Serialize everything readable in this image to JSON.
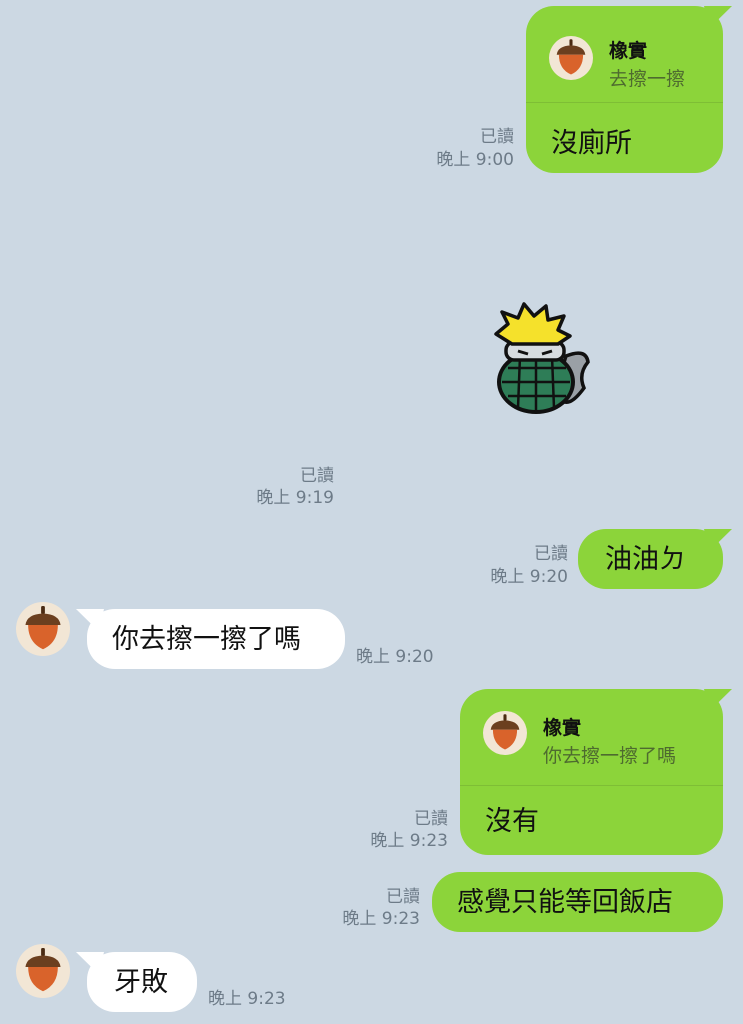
{
  "chat": {
    "messages": [
      {
        "id": "m1",
        "side": "sent",
        "reply": {
          "name": "橡實",
          "quote": "去擦一擦"
        },
        "text": "沒廁所",
        "read": "已讀",
        "time": "晚上 9:00"
      },
      {
        "id": "m2",
        "side": "sent",
        "sticker": "grenade-character-sticker",
        "read": "已讀",
        "time": "晚上 9:19"
      },
      {
        "id": "m3",
        "side": "sent",
        "text": "油油ㄉ",
        "read": "已讀",
        "time": "晚上 9:20"
      },
      {
        "id": "m4",
        "side": "received",
        "text": "你去擦一擦了嗎",
        "time": "晚上 9:20"
      },
      {
        "id": "m5",
        "side": "sent",
        "reply": {
          "name": "橡實",
          "quote": "你去擦一擦了嗎"
        },
        "text": "沒有",
        "read": "已讀",
        "time": "晚上 9:23"
      },
      {
        "id": "m6",
        "side": "sent",
        "text": "感覺只能等回飯店",
        "read": "已讀",
        "time": "晚上 9:23"
      },
      {
        "id": "m7",
        "side": "received",
        "text": "牙敗",
        "time": "晚上 9:23"
      }
    ]
  },
  "icons": {
    "avatar": "acorn-icon",
    "sticker": "grenade-character-sticker"
  },
  "colors": {
    "background": "#CCD8E3",
    "sent_bubble": "#8CD43A",
    "received_bubble": "#FFFFFF",
    "meta_text": "#6D7B88",
    "acorn_cap": "#6B3F1F",
    "acorn_body": "#D9632B",
    "grenade": "#2E7D57",
    "hair": "#F5E12B"
  }
}
